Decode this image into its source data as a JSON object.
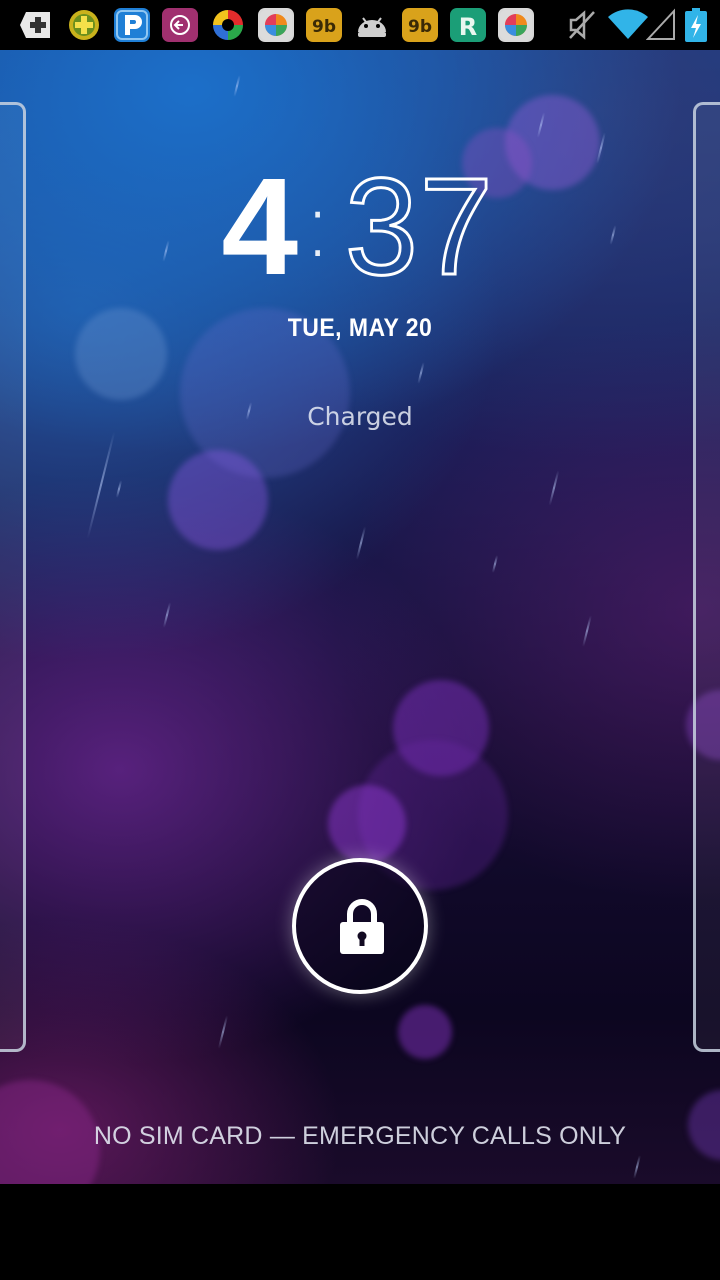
{
  "status_bar": {
    "notification_icons": [
      "plus-badge-icon",
      "yellow-plus-icon",
      "p-app-icon",
      "back-circle-icon",
      "color-wheel-icon",
      "colorful-ball-icon",
      "butterfly-app-icon",
      "android-robot-icon",
      "butterfly-app-icon",
      "r-app-icon",
      "colorful-ball-icon"
    ],
    "system_icons": [
      "mute-icon",
      "wifi-icon",
      "signal-icon",
      "battery-charging-icon"
    ]
  },
  "lockscreen": {
    "clock": {
      "hour": "4",
      "separator": ":",
      "minutes": "37"
    },
    "date": "TUE, MAY 20",
    "charge_status": "Charged",
    "carrier_text": "NO SIM CARD — EMERGENCY CALLS ONLY",
    "lock_icon": "padlock-icon"
  },
  "colors": {
    "notif_p": "#1f7fd6",
    "notif_back": "#a0306f",
    "notif_butterfly": "#d9a21b",
    "notif_r": "#1b9e77",
    "wifi": "#31b4e8",
    "battery": "#31b4e8"
  }
}
